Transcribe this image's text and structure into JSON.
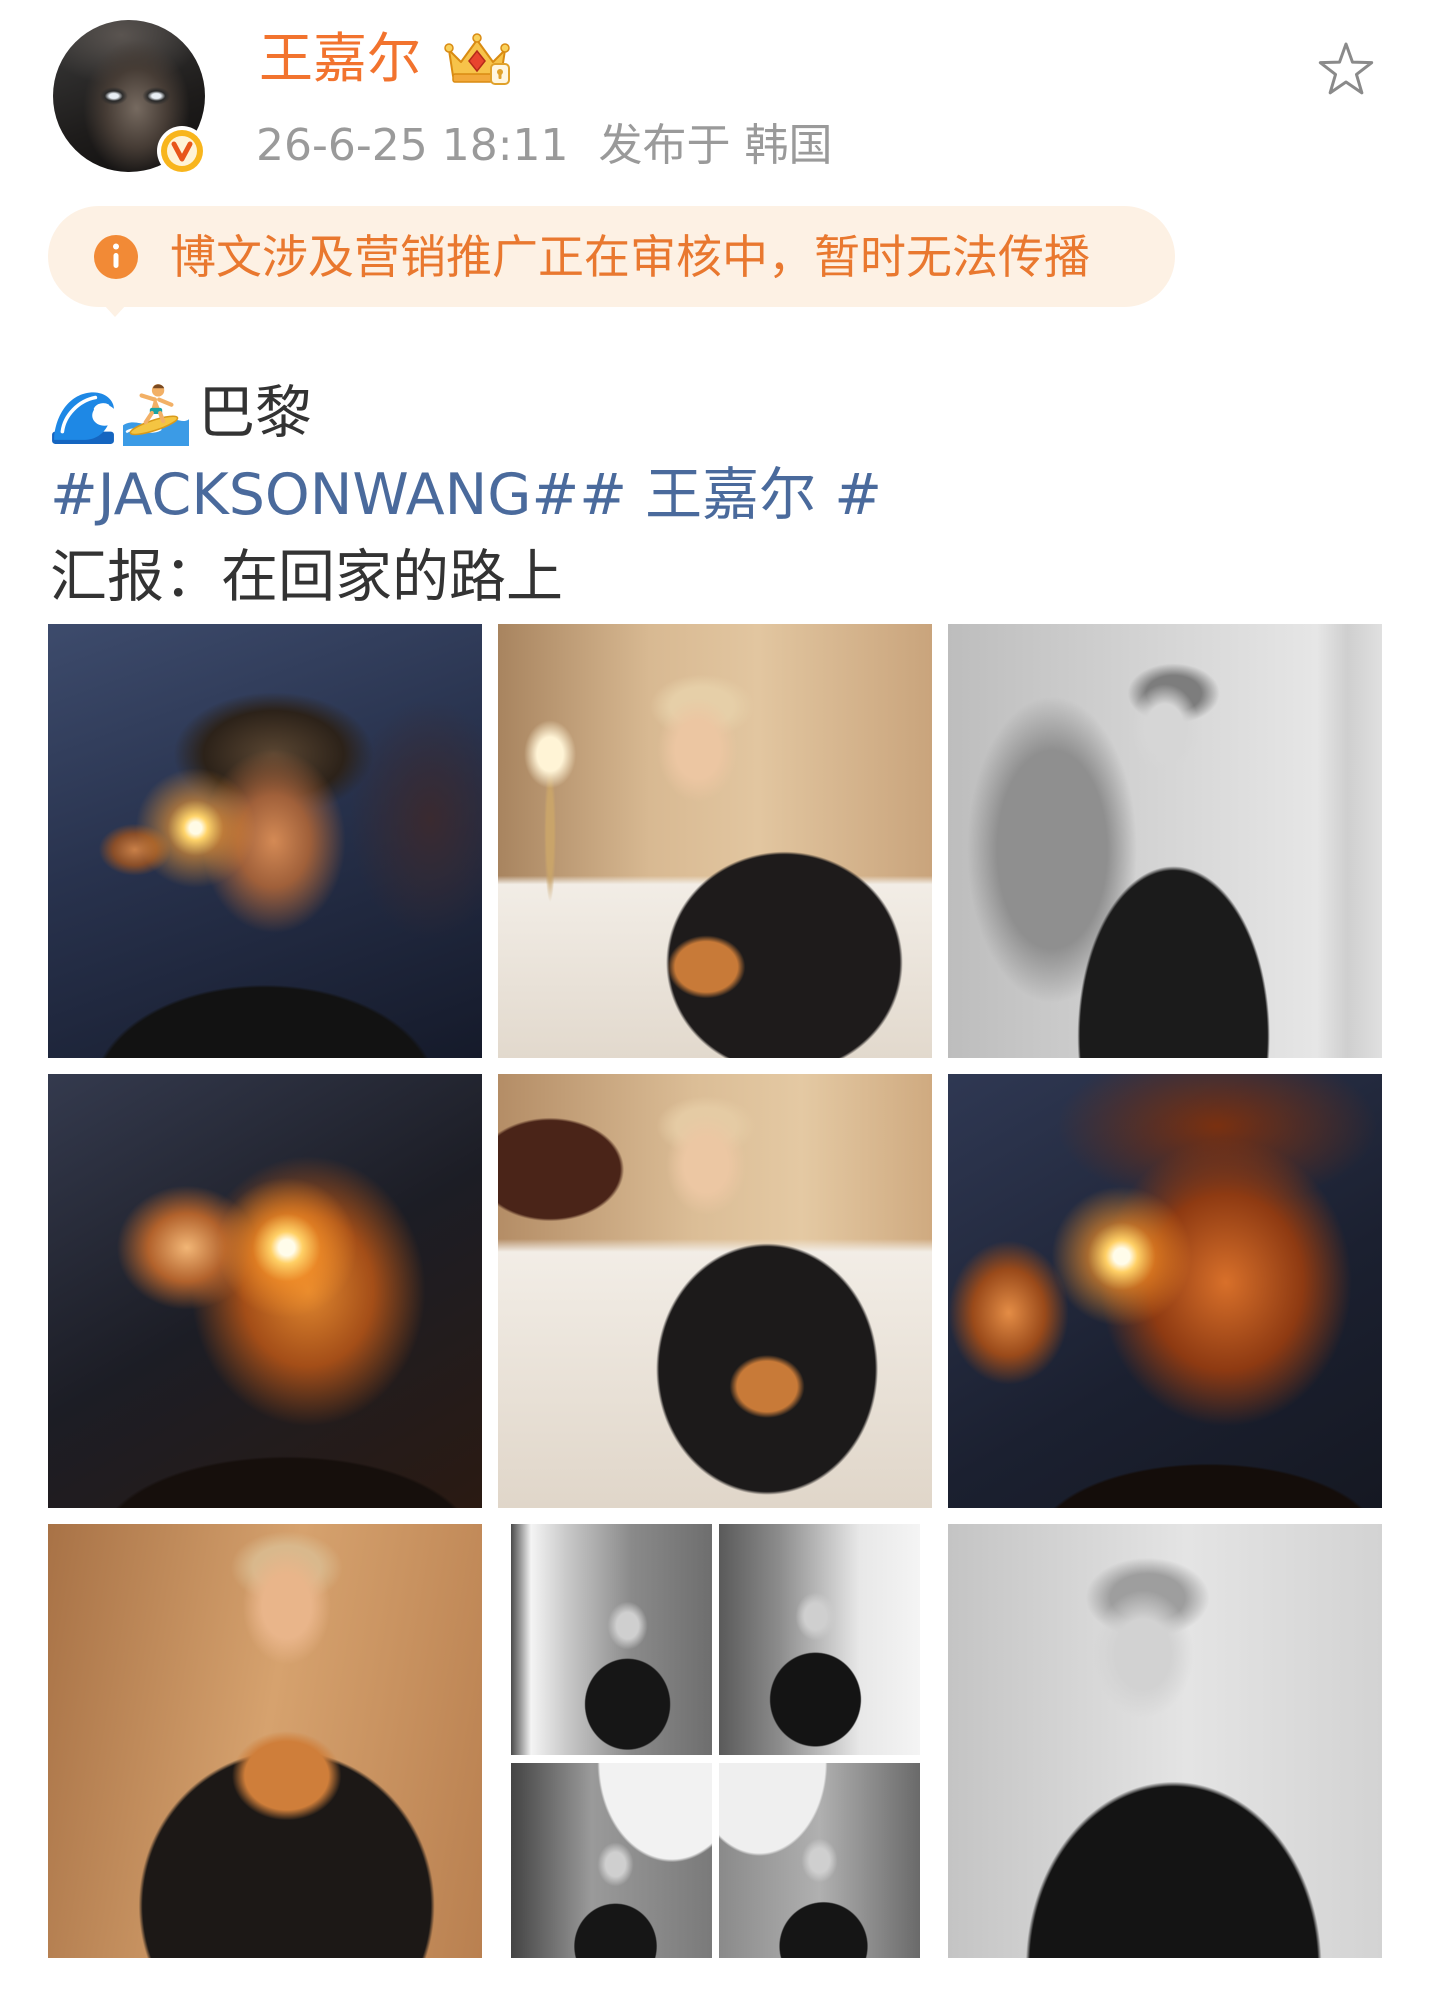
{
  "theme": {
    "accent": "#f2732e",
    "link": "#4a6a9c",
    "text": "#333333",
    "muted": "#9a9a9a",
    "notice_bg": "#fdf1e4",
    "notice_fg": "#e9782f"
  },
  "user": {
    "name": "王嘉尔",
    "avatar_icon": "user-avatar-photo",
    "verified_icon": "verified-badge-icon",
    "member_icon": "member-crown-icon"
  },
  "post": {
    "timestamp": "26-6-25 18:11",
    "location": "发布于 韩国",
    "favorite_icon": "star-outline-icon"
  },
  "notice": {
    "icon": "info-icon",
    "text": "博文涉及营销推广正在审核中，暂时无法传播"
  },
  "content": {
    "line1": {
      "emoji_icons": [
        "water-wave-icon",
        "person-surfing-icon"
      ],
      "text": "巴黎"
    },
    "topics": [
      "#JACKSONWANG#",
      "# 王嘉尔 #"
    ],
    "line3": "汇报：在回家的路上"
  }
}
